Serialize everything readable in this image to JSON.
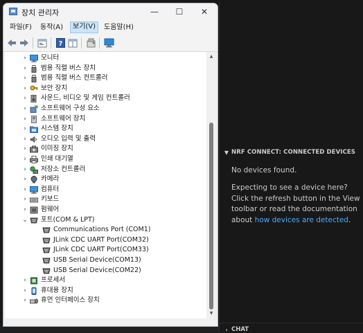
{
  "device_manager": {
    "title": "장치 관리자",
    "window_buttons": {
      "minimize": "—",
      "maximize": "☐",
      "close": "✕"
    },
    "menu": [
      {
        "label": "파일(F)"
      },
      {
        "label": "동작(A)"
      },
      {
        "label": "보기(V)",
        "active": true
      },
      {
        "label": "도움말(H)"
      }
    ],
    "toolbar": [
      "back-icon",
      "forward-icon",
      "properties-icon",
      "help-icon",
      "grid-icon",
      "update-driver-icon",
      "monitor-icon"
    ],
    "tree": [
      {
        "label": "모니터",
        "icon": "monitor-icon",
        "expanded": false
      },
      {
        "label": "범용 직렬 버스 장치",
        "icon": "usb-icon",
        "expanded": false
      },
      {
        "label": "범용 직렬 버스 컨트롤러",
        "icon": "usb-icon",
        "expanded": false
      },
      {
        "label": "보안 장치",
        "icon": "security-key-icon",
        "expanded": false
      },
      {
        "label": "사운드, 비디오 및 게임 컨트롤러",
        "icon": "speaker-icon",
        "expanded": false
      },
      {
        "label": "소프트웨어 구성 요소",
        "icon": "component-icon",
        "expanded": false
      },
      {
        "label": "소프트웨어 장치",
        "icon": "software-device-icon",
        "expanded": false
      },
      {
        "label": "시스템 장치",
        "icon": "system-folder-icon",
        "expanded": false
      },
      {
        "label": "오디오 입력 및 출력",
        "icon": "audio-icon",
        "expanded": false
      },
      {
        "label": "이미징 장치",
        "icon": "camera-device-icon",
        "expanded": false
      },
      {
        "label": "인쇄 대기열",
        "icon": "printer-icon",
        "expanded": false
      },
      {
        "label": "저장소 컨트롤러",
        "icon": "storage-controller-icon",
        "expanded": false
      },
      {
        "label": "카메라",
        "icon": "webcam-icon",
        "expanded": false
      },
      {
        "label": "컴퓨터",
        "icon": "computer-icon",
        "expanded": false
      },
      {
        "label": "키보드",
        "icon": "keyboard-icon",
        "expanded": false
      },
      {
        "label": "펌웨어",
        "icon": "firmware-icon",
        "expanded": false
      },
      {
        "label": "포트(COM & LPT)",
        "icon": "port-icon",
        "expanded": true,
        "children": [
          {
            "label": "Communications Port (COM1)",
            "icon": "port-icon"
          },
          {
            "label": "JLink CDC UART Port(COM32)",
            "icon": "port-icon"
          },
          {
            "label": "JLink CDC UART Port(COM33)",
            "icon": "port-icon"
          },
          {
            "label": "USB Serial Device(COM13)",
            "icon": "port-icon"
          },
          {
            "label": "USB Serial Device(COM22)",
            "icon": "port-icon"
          }
        ]
      },
      {
        "label": "프로세서",
        "icon": "processor-icon",
        "expanded": false
      },
      {
        "label": "휴대용 장치",
        "icon": "portable-device-icon",
        "expanded": false
      },
      {
        "label": "휴먼 인터페이스 장치",
        "icon": "hid-icon",
        "expanded": false
      }
    ]
  },
  "vscode_panel": {
    "header": "NRF CONNECT: CONNECTED DEVICES",
    "no_devices": "No devices found.",
    "hint_before_link": "Expecting to see a device here? Click the refresh button in the View toolbar or read the documentation about ",
    "hint_link": "how devices are detected",
    "hint_after_link": ".",
    "chat_header": "CHAT"
  },
  "colors": {
    "link": "#4daafc",
    "panel_bg": "#181818",
    "menu_active": "#cce4f7"
  }
}
